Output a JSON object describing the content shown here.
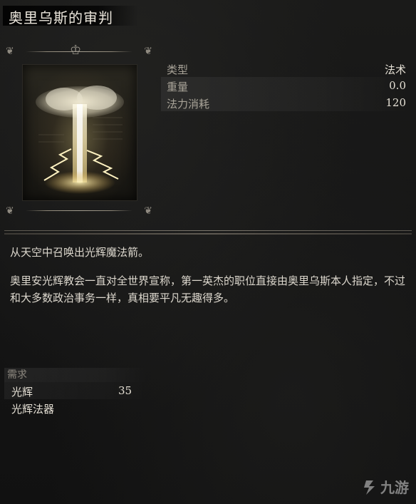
{
  "item": {
    "title": "奥里乌斯的审判"
  },
  "stats": [
    {
      "label": "类型",
      "value": "法术"
    },
    {
      "label": "重量",
      "value": "0.0"
    },
    {
      "label": "法力消耗",
      "value": "120"
    }
  ],
  "description": {
    "line1": "从天空中召唤出光辉魔法箭。",
    "line2": "奥里安光辉教会一直对全世界宣称，第一英杰的职位直接由奥里乌斯本人指定，不过和大多数政治事务一样，真相要平凡无趣得多。"
  },
  "requirements": {
    "header": "需求",
    "rows": [
      {
        "name": "光辉",
        "value": "35"
      },
      {
        "name": "光辉法器",
        "value": ""
      }
    ]
  },
  "watermark": {
    "text": "九游"
  },
  "colors": {
    "background": "#141414",
    "text": "#e6e1d8",
    "label": "#a8a398"
  },
  "icons": [
    "spell-icon",
    "watermark-logo-icon"
  ]
}
